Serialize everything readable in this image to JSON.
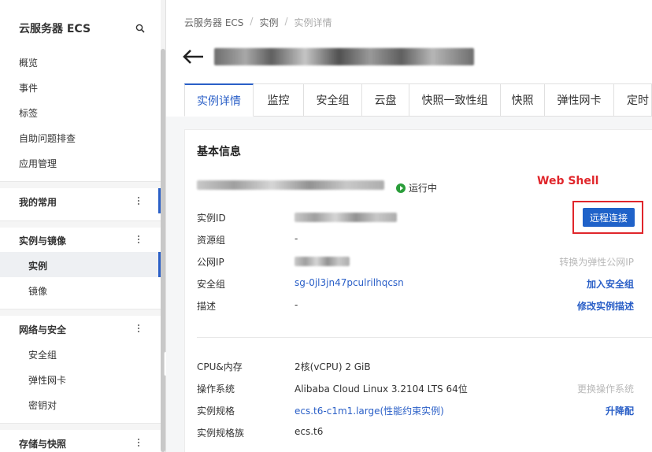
{
  "sidebar": {
    "title": "云服务器 ECS",
    "top_items": [
      "概览",
      "事件",
      "标签",
      "自助问题排查",
      "应用管理"
    ],
    "groups": [
      {
        "label": "我的常用"
      },
      {
        "label": "实例与镜像",
        "items": [
          "实例",
          "镜像"
        ]
      },
      {
        "label": "网络与安全",
        "items": [
          "安全组",
          "弹性网卡",
          "密钥对"
        ]
      },
      {
        "label": "存储与快照"
      }
    ],
    "active_item": "实例"
  },
  "breadcrumb": [
    "云服务器 ECS",
    "实例",
    "实例详情"
  ],
  "tabs": [
    "实例详情",
    "监控",
    "安全组",
    "云盘",
    "快照一致性组",
    "快照",
    "弹性网卡",
    "定时"
  ],
  "active_tab": "实例详情",
  "basic_info": {
    "section_title": "基本信息",
    "status": "运行中",
    "webshell_annotation": "Web Shell",
    "remote_button": "远程连接",
    "rows": [
      {
        "label": "实例ID",
        "value": ""
      },
      {
        "label": "资源组",
        "value": "-"
      },
      {
        "label": "公网IP",
        "value": "",
        "action": "转换为弹性公网IP"
      },
      {
        "label": "安全组",
        "value": "sg-0jl3jn47pculrilhqcsn",
        "action": "加入安全组"
      },
      {
        "label": "描述",
        "value": "-",
        "action": "修改实例描述"
      }
    ],
    "config_rows": [
      {
        "label": "CPU&内存",
        "value": "2核(vCPU) 2 GiB"
      },
      {
        "label": "操作系统",
        "value": "Alibaba Cloud Linux 3.2104 LTS 64位",
        "action": "更换操作系统"
      },
      {
        "label": "实例规格",
        "value": "ecs.t6-c1m1.large(性能约束实例)",
        "action": "升降配"
      },
      {
        "label": "实例规格族",
        "value": "ecs.t6"
      }
    ]
  },
  "colors": {
    "accent": "#2a5fc7",
    "annotation": "#e0262b",
    "status_running": "#2a9d3a"
  }
}
